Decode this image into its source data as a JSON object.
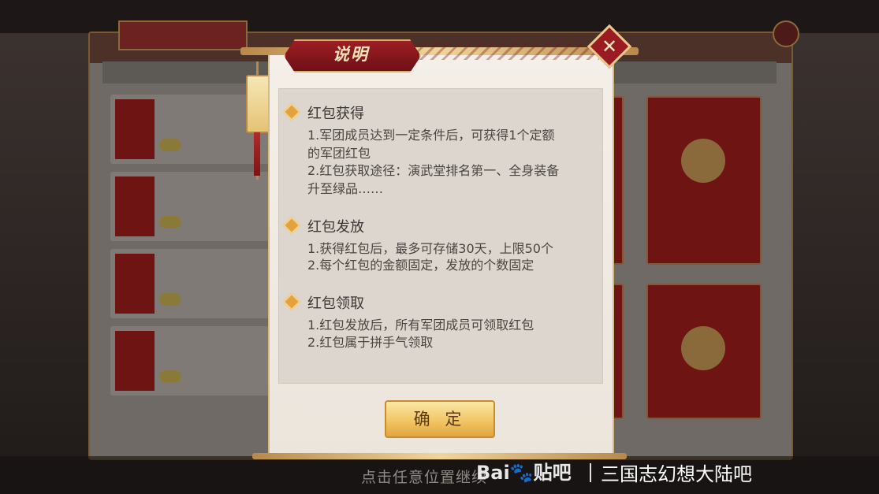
{
  "dialog": {
    "title": "说明",
    "close_icon": "close-icon",
    "sections": [
      {
        "title": "红包获得",
        "lines": [
          "1.军团成员达到一定条件后，可获得1个定额",
          "的军团红包",
          "2.红包获取途径：演武堂排名第一、全身装备",
          "升至绿品……"
        ]
      },
      {
        "title": "红包发放",
        "lines": [
          "1.获得红包后，最多可存储30天，上限50个",
          "2.每个红包的金额固定，发放的个数固定"
        ]
      },
      {
        "title": "红包领取",
        "lines": [
          "1.红包发放后，所有军团成员可领取红包",
          "2.红包属于拼手气领取"
        ]
      }
    ],
    "confirm_label": "确 定"
  },
  "background": {
    "tip_text": "点击任意位置继续"
  },
  "watermark": {
    "logo": "Bai🐾贴吧",
    "forum": "三国志幻想大陆吧"
  },
  "colors": {
    "ribbon": "#8a1a20",
    "gold": "#e3b25a",
    "panel": "#efe9e1"
  }
}
